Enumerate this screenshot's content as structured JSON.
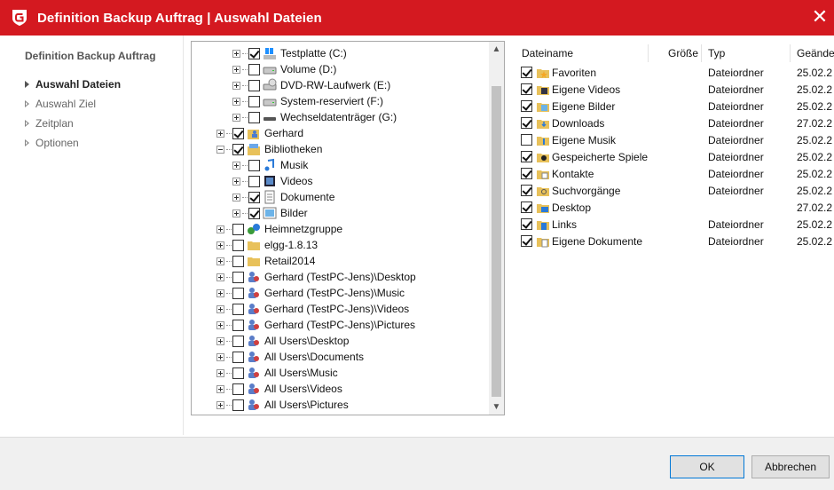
{
  "window": {
    "title": "Definition Backup Auftrag | Auswahl Dateien",
    "accent": "#d41920",
    "close_symbol": "✕"
  },
  "nav": {
    "heading": "Definition Backup Auftrag",
    "items": [
      {
        "label": "Auswahl Dateien",
        "active": true
      },
      {
        "label": "Auswahl Ziel",
        "active": false
      },
      {
        "label": "Zeitplan",
        "active": false
      },
      {
        "label": "Optionen",
        "active": false
      }
    ]
  },
  "tree": {
    "items": [
      {
        "label": "Testplatte (C:)",
        "checked": true,
        "icon": "windows-drive-icon"
      },
      {
        "label": "Volume (D:)",
        "checked": false,
        "icon": "hard-drive-icon"
      },
      {
        "label": "DVD-RW-Laufwerk (E:)",
        "checked": false,
        "icon": "dvd-drive-icon"
      },
      {
        "label": "System-reserviert (F:)",
        "checked": false,
        "icon": "hard-drive-icon"
      },
      {
        "label": "Wechseldatenträger (G:)",
        "checked": false,
        "icon": "usb-drive-icon"
      },
      {
        "label": "Gerhard",
        "checked": true,
        "icon": "user-folder-icon"
      },
      {
        "label": "Bibliotheken",
        "checked": true,
        "icon": "libraries-icon"
      },
      {
        "label": "Musik",
        "checked": false,
        "icon": "music-icon"
      },
      {
        "label": "Videos",
        "checked": false,
        "icon": "video-icon"
      },
      {
        "label": "Dokumente",
        "checked": true,
        "icon": "document-icon"
      },
      {
        "label": "Bilder",
        "checked": true,
        "icon": "picture-icon"
      },
      {
        "label": "Heimnetzgruppe",
        "checked": false,
        "icon": "homegroup-icon"
      },
      {
        "label": "elgg-1.8.13",
        "checked": false,
        "icon": "folder-icon"
      },
      {
        "label": "Retail2014",
        "checked": false,
        "icon": "folder-icon"
      },
      {
        "label": "Gerhard (TestPC-Jens)\\Desktop",
        "checked": false,
        "icon": "shared-users-icon"
      },
      {
        "label": "Gerhard (TestPC-Jens)\\Music",
        "checked": false,
        "icon": "shared-users-icon"
      },
      {
        "label": "Gerhard (TestPC-Jens)\\Videos",
        "checked": false,
        "icon": "shared-users-icon"
      },
      {
        "label": "Gerhard (TestPC-Jens)\\Pictures",
        "checked": false,
        "icon": "shared-users-icon"
      },
      {
        "label": "All Users\\Desktop",
        "checked": false,
        "icon": "shared-users-icon"
      },
      {
        "label": "All Users\\Documents",
        "checked": false,
        "icon": "shared-users-icon"
      },
      {
        "label": "All Users\\Music",
        "checked": false,
        "icon": "shared-users-icon"
      },
      {
        "label": "All Users\\Videos",
        "checked": false,
        "icon": "shared-users-icon"
      },
      {
        "label": "All Users\\Pictures",
        "checked": false,
        "icon": "shared-users-icon"
      }
    ]
  },
  "files": {
    "columns": [
      "Dateiname",
      "Größe",
      "Typ",
      "Geände"
    ],
    "rows": [
      {
        "name": "Favoriten",
        "type": "Dateiordner",
        "date": "25.02.2",
        "checked": true,
        "icon": "favorites-folder-icon"
      },
      {
        "name": "Eigene Videos",
        "type": "Dateiordner",
        "date": "25.02.2",
        "checked": true,
        "icon": "videos-folder-icon"
      },
      {
        "name": "Eigene Bilder",
        "type": "Dateiordner",
        "date": "25.02.2",
        "checked": true,
        "icon": "pictures-folder-icon"
      },
      {
        "name": "Downloads",
        "type": "Dateiordner",
        "date": "27.02.2",
        "checked": true,
        "icon": "downloads-folder-icon"
      },
      {
        "name": "Eigene Musik",
        "type": "Dateiordner",
        "date": "25.02.2",
        "checked": false,
        "icon": "music-folder-icon"
      },
      {
        "name": "Gespeicherte Spiele",
        "type": "Dateiordner",
        "date": "25.02.2",
        "checked": true,
        "icon": "games-folder-icon"
      },
      {
        "name": "Kontakte",
        "type": "Dateiordner",
        "date": "25.02.2",
        "checked": true,
        "icon": "contacts-folder-icon"
      },
      {
        "name": "Suchvorgänge",
        "type": "Dateiordner",
        "date": "25.02.2",
        "checked": true,
        "icon": "search-folder-icon"
      },
      {
        "name": "Desktop",
        "type": "",
        "date": "27.02.2",
        "checked": true,
        "icon": "desktop-folder-icon"
      },
      {
        "name": "Links",
        "type": "Dateiordner",
        "date": "25.02.2",
        "checked": true,
        "icon": "links-folder-icon"
      },
      {
        "name": "Eigene Dokumente",
        "type": "Dateiordner",
        "date": "25.02.2",
        "checked": true,
        "icon": "documents-folder-icon"
      }
    ]
  },
  "footer": {
    "ok_label": "OK",
    "cancel_label": "Abbrechen"
  }
}
